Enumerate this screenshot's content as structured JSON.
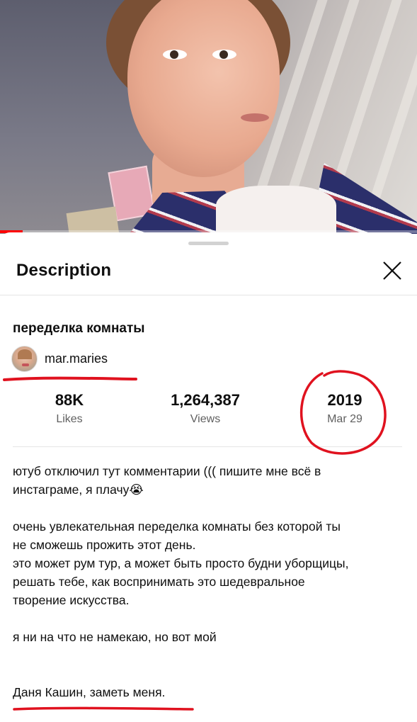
{
  "video": {
    "progress_fraction": 0.055
  },
  "sheet": {
    "title": "Description",
    "close_icon": "close-icon"
  },
  "video_info": {
    "title": "переделка комнаты",
    "channel_name": "mar.maries"
  },
  "stats": [
    {
      "value": "88K",
      "label": "Likes"
    },
    {
      "value": "1,264,387",
      "label": "Views"
    },
    {
      "value": "2019",
      "label": "Mar 29"
    }
  ],
  "description_lines": [
    "ютуб отключил тут комментарии ((( пишите мне всё в",
    "инстаграме, я плачу😭",
    "",
    "очень увлекательная переделка комнаты без которой ты",
    "не сможешь прожить этот день.",
    "это может рум тур, а может быть просто будни уборщицы,",
    "решать тебе, как воспринимать это шедевральное",
    "творение искусства.",
    "",
    "я ни на что не намекаю, но вот мой",
    "",
    "",
    "Даня Кашин, заметь меня."
  ],
  "annotation_color": "#e0121f",
  "accent_color": "#ff0000"
}
